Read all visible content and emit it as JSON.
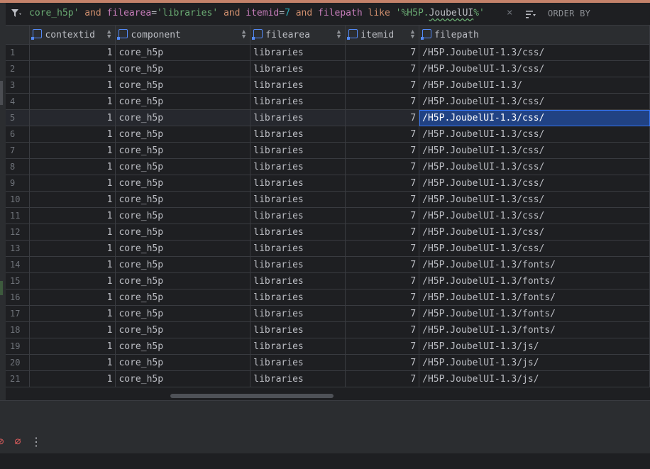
{
  "filter": {
    "tokens": [
      {
        "t": "core_h5p'",
        "k": "str"
      },
      {
        "t": " and ",
        "k": "kw"
      },
      {
        "t": "filearea",
        "k": "id"
      },
      {
        "t": "=",
        "k": "op"
      },
      {
        "t": "'libraries'",
        "k": "str"
      },
      {
        "t": " and ",
        "k": "kw"
      },
      {
        "t": "itemid",
        "k": "id"
      },
      {
        "t": "=",
        "k": "op"
      },
      {
        "t": "7",
        "k": "num"
      },
      {
        "t": " and ",
        "k": "kw"
      },
      {
        "t": "filepath",
        "k": "id"
      },
      {
        "t": " like ",
        "k": "kw"
      },
      {
        "t": "'%H5P.",
        "k": "str"
      },
      {
        "t": "JoubelUI",
        "k": "squig"
      },
      {
        "t": "%'",
        "k": "str"
      }
    ],
    "clear_symbol": "×",
    "order_by_label": "ORDER BY"
  },
  "table": {
    "columns": [
      "contextid",
      "component",
      "filearea",
      "itemid",
      "filepath"
    ],
    "selected_row": 5,
    "rows": [
      [
        "1",
        "1",
        "core_h5p",
        "libraries",
        "7",
        "/H5P.JoubelUI-1.3/css/"
      ],
      [
        "2",
        "1",
        "core_h5p",
        "libraries",
        "7",
        "/H5P.JoubelUI-1.3/css/"
      ],
      [
        "3",
        "1",
        "core_h5p",
        "libraries",
        "7",
        "/H5P.JoubelUI-1.3/"
      ],
      [
        "4",
        "1",
        "core_h5p",
        "libraries",
        "7",
        "/H5P.JoubelUI-1.3/css/"
      ],
      [
        "5",
        "1",
        "core_h5p",
        "libraries",
        "7",
        "/H5P.JoubelUI-1.3/css/"
      ],
      [
        "6",
        "1",
        "core_h5p",
        "libraries",
        "7",
        "/H5P.JoubelUI-1.3/css/"
      ],
      [
        "7",
        "1",
        "core_h5p",
        "libraries",
        "7",
        "/H5P.JoubelUI-1.3/css/"
      ],
      [
        "8",
        "1",
        "core_h5p",
        "libraries",
        "7",
        "/H5P.JoubelUI-1.3/css/"
      ],
      [
        "9",
        "1",
        "core_h5p",
        "libraries",
        "7",
        "/H5P.JoubelUI-1.3/css/"
      ],
      [
        "10",
        "1",
        "core_h5p",
        "libraries",
        "7",
        "/H5P.JoubelUI-1.3/css/"
      ],
      [
        "11",
        "1",
        "core_h5p",
        "libraries",
        "7",
        "/H5P.JoubelUI-1.3/css/"
      ],
      [
        "12",
        "1",
        "core_h5p",
        "libraries",
        "7",
        "/H5P.JoubelUI-1.3/css/"
      ],
      [
        "13",
        "1",
        "core_h5p",
        "libraries",
        "7",
        "/H5P.JoubelUI-1.3/css/"
      ],
      [
        "14",
        "1",
        "core_h5p",
        "libraries",
        "7",
        "/H5P.JoubelUI-1.3/fonts/"
      ],
      [
        "15",
        "1",
        "core_h5p",
        "libraries",
        "7",
        "/H5P.JoubelUI-1.3/fonts/"
      ],
      [
        "16",
        "1",
        "core_h5p",
        "libraries",
        "7",
        "/H5P.JoubelUI-1.3/fonts/"
      ],
      [
        "17",
        "1",
        "core_h5p",
        "libraries",
        "7",
        "/H5P.JoubelUI-1.3/fonts/"
      ],
      [
        "18",
        "1",
        "core_h5p",
        "libraries",
        "7",
        "/H5P.JoubelUI-1.3/fonts/"
      ],
      [
        "19",
        "1",
        "core_h5p",
        "libraries",
        "7",
        "/H5P.JoubelUI-1.3/js/"
      ],
      [
        "20",
        "1",
        "core_h5p",
        "libraries",
        "7",
        "/H5P.JoubelUI-1.3/js/"
      ],
      [
        "21",
        "1",
        "core_h5p",
        "libraries",
        "7",
        "/H5P.JoubelUI-1.3/js/"
      ]
    ]
  },
  "toolbar": {
    "stop_symbol": "⊘",
    "disconnect_symbol": "⌀",
    "more_symbol": "⋮"
  },
  "colors": {
    "background": "#1e1f22",
    "header": "#2b2d30",
    "selection": "#214283",
    "accent_top": "#c4826a"
  }
}
